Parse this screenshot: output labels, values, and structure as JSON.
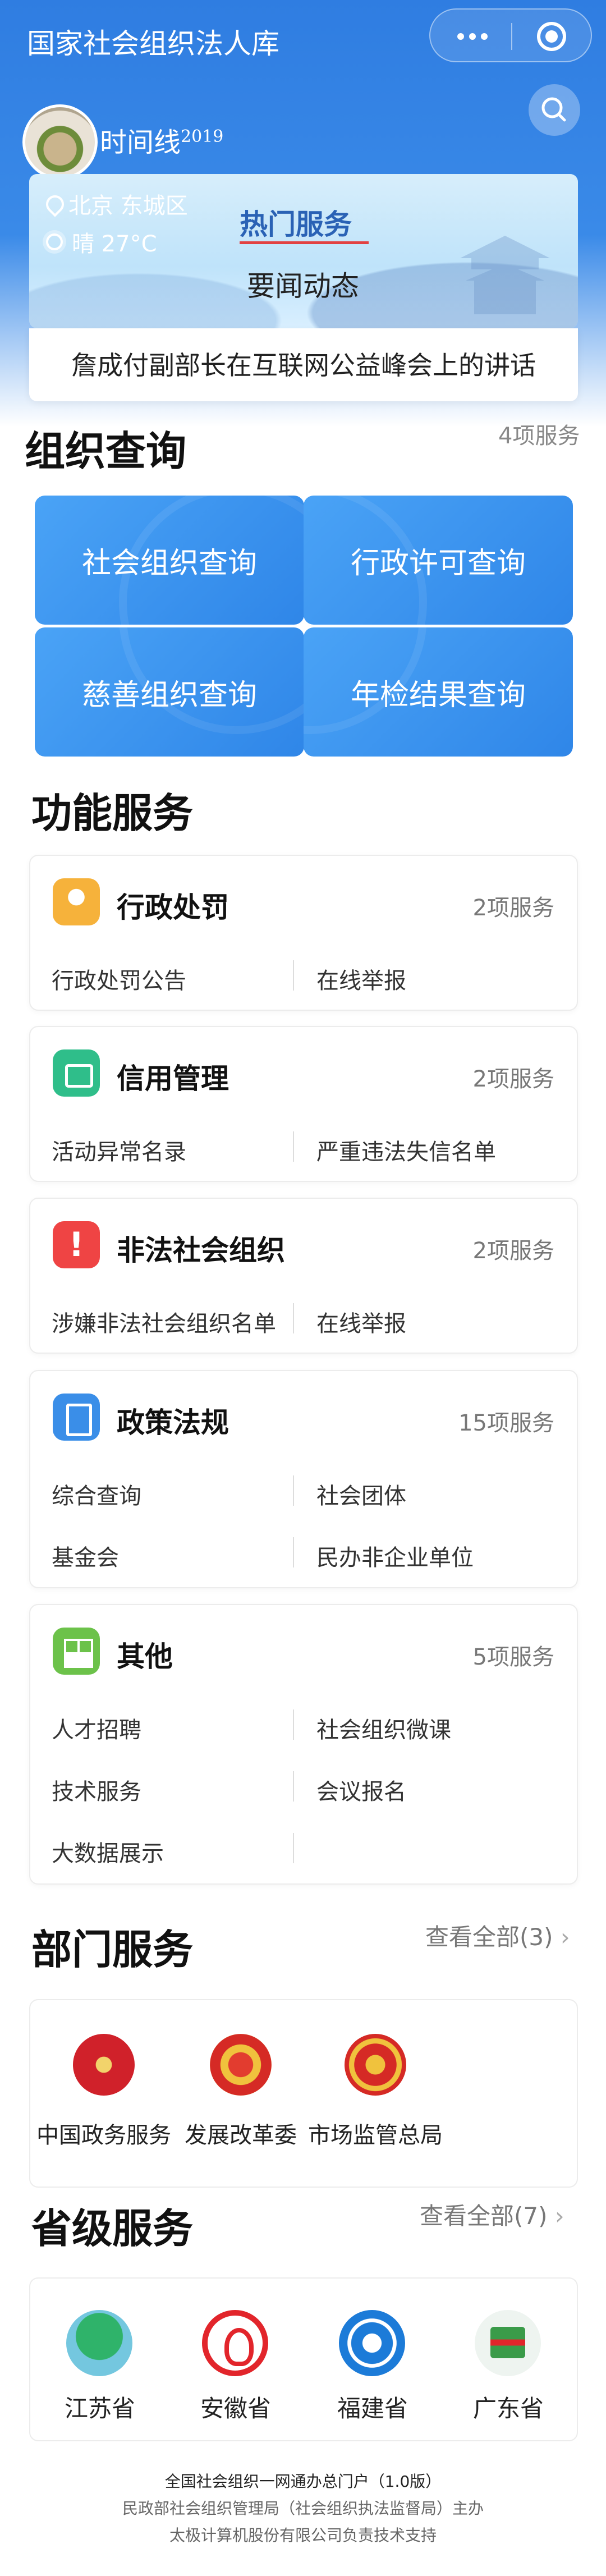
{
  "header": {
    "app_title": "国家社会组织法人库",
    "moment_title": "时间线",
    "moment_year": "2019"
  },
  "banner": {
    "location": "北京 东城区",
    "weather": "晴 27°C",
    "hot_service": "热门服务",
    "news": "要闻动态",
    "headline": "詹成付副部长在互联网公益峰会上的讲话"
  },
  "org_query": {
    "title": "组织查询",
    "count": "4项服务",
    "tiles": [
      {
        "label": "社会组织查询"
      },
      {
        "label": "行政许可查询"
      },
      {
        "label": "慈善组织查询"
      },
      {
        "label": "年检结果查询"
      }
    ]
  },
  "function_services": {
    "title": "功能服务",
    "cards": [
      {
        "title": "行政处罚",
        "count": "2项服务",
        "items": [
          "行政处罚公告",
          "在线举报"
        ]
      },
      {
        "title": "信用管理",
        "count": "2项服务",
        "items": [
          "活动异常名录",
          "严重违法失信名单"
        ]
      },
      {
        "title": "非法社会组织",
        "count": "2项服务",
        "items": [
          "涉嫌非法社会组织名单",
          "在线举报"
        ]
      },
      {
        "title": "政策法规",
        "count": "15项服务",
        "items": [
          "综合查询",
          "社会团体",
          "基金会",
          "民办非企业单位"
        ]
      },
      {
        "title": "其他",
        "count": "5项服务",
        "items": [
          "人才招聘",
          "社会组织微课",
          "技术服务",
          "会议报名",
          "大数据展示"
        ]
      }
    ]
  },
  "dept_services": {
    "title": "部门服务",
    "more": "查看全部(3)",
    "items": [
      {
        "label": "中国政务服务"
      },
      {
        "label": "发展改革委"
      },
      {
        "label": "市场监管总局"
      }
    ]
  },
  "prov_services": {
    "title": "省级服务",
    "more": "查看全部(7)",
    "items": [
      {
        "label": "江苏省"
      },
      {
        "label": "安徽省"
      },
      {
        "label": "福建省"
      },
      {
        "label": "广东省"
      }
    ]
  },
  "footer": {
    "line1": "全国社会组织一网通办总门户（1.0版）",
    "line2": "民政部社会组织管理局（社会组织执法监督局）主办",
    "line3": "太极计算机股份有限公司负责技术支持"
  }
}
